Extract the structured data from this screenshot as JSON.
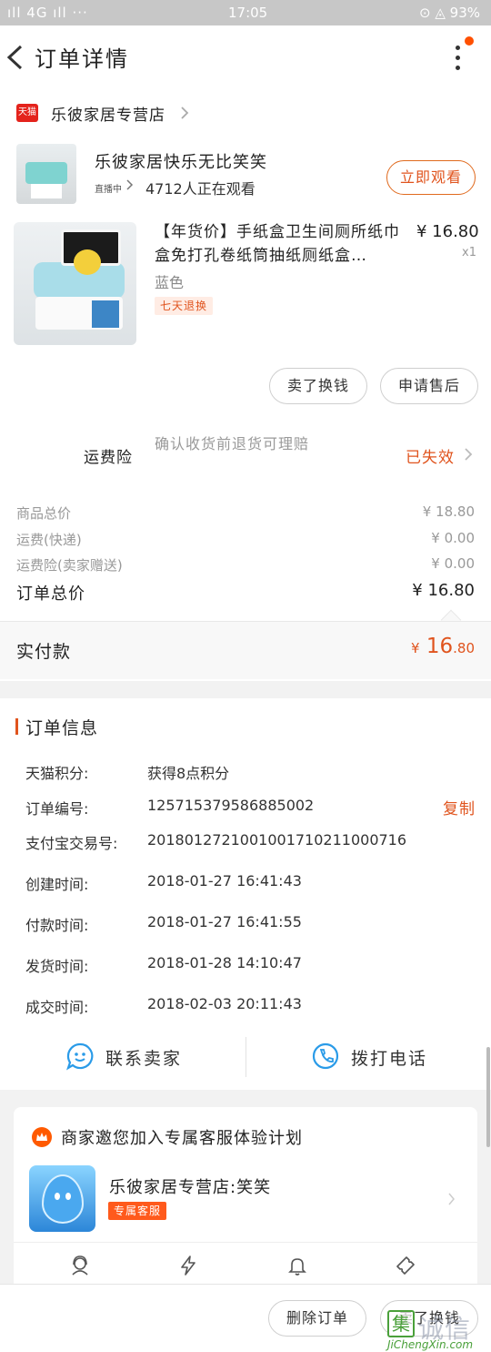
{
  "status_bar": {
    "signal": "ıll 4G ıll ···",
    "time": "17:05",
    "battery": "⊙ ◬ 93%"
  },
  "nav": {
    "title": "订单详情",
    "back_icon": "chevron-left-icon",
    "more_icon": "more-vertical-icon"
  },
  "shop": {
    "badge": "天猫",
    "name": "乐彼家居专营店"
  },
  "live": {
    "title": "乐彼家居快乐无比笑笑",
    "tag": "直播中",
    "viewers": "4712人正在观看",
    "watch_button": "立即观看"
  },
  "product": {
    "title": "【年货价】手纸盒卫生间厕所纸巾盒免打孔卷纸筒抽纸厕纸盒…",
    "price": "¥ 16.80",
    "quantity": "x1",
    "sku": "蓝色",
    "return_tag": "七天退换"
  },
  "actions": {
    "sell_for_cash": "卖了换钱",
    "after_sale": "申请售后"
  },
  "freight_insurance": {
    "label": "运费险",
    "desc": "确认收货前退货可理赔",
    "status": "已失效"
  },
  "summary": {
    "rows": [
      {
        "label": "商品总价",
        "value": "¥ 18.80"
      },
      {
        "label": "运费(快递)",
        "value": "¥ 0.00"
      },
      {
        "label": "运费险(卖家赠送)",
        "value": "¥ 0.00"
      }
    ],
    "total_label": "订单总价",
    "total_value": "¥ 16.80",
    "paid_label": "实付款",
    "paid_symbol": "¥",
    "paid_int": " 16",
    "paid_dec": ".80"
  },
  "order_info": {
    "title": "订单信息",
    "rows": [
      {
        "key": "天猫积分:",
        "value": "获得8点积分"
      },
      {
        "key": "订单编号:",
        "value": "125715379586885002"
      },
      {
        "key": "支付宝交易号:",
        "value": "2018012721001001710211000716"
      },
      {
        "key": "创建时间:",
        "value": "2018-01-27 16:41:43"
      },
      {
        "key": "付款时间:",
        "value": "2018-01-27 16:41:55"
      },
      {
        "key": "发货时间:",
        "value": "2018-01-28 14:10:47"
      },
      {
        "key": "成交时间:",
        "value": "2018-02-03 20:11:43"
      }
    ],
    "copy_label": "复制"
  },
  "contact": {
    "seller": "联系卖家",
    "phone": "拨打电话"
  },
  "service_card": {
    "title": "商家邀您加入专属客服体验计划",
    "shop": "乐彼家居专营店:笑笑",
    "tag": "专属客服"
  },
  "bottom": {
    "delete_order": "删除订单",
    "sell_for_cash": "卖了换钱"
  },
  "watermark": {
    "box": "集",
    "text": "诚信",
    "url": "JiChengXin.com"
  },
  "colors": {
    "accent": "#e0541e",
    "tmall_red": "#e4231c",
    "contact_blue": "#2a9be8"
  }
}
